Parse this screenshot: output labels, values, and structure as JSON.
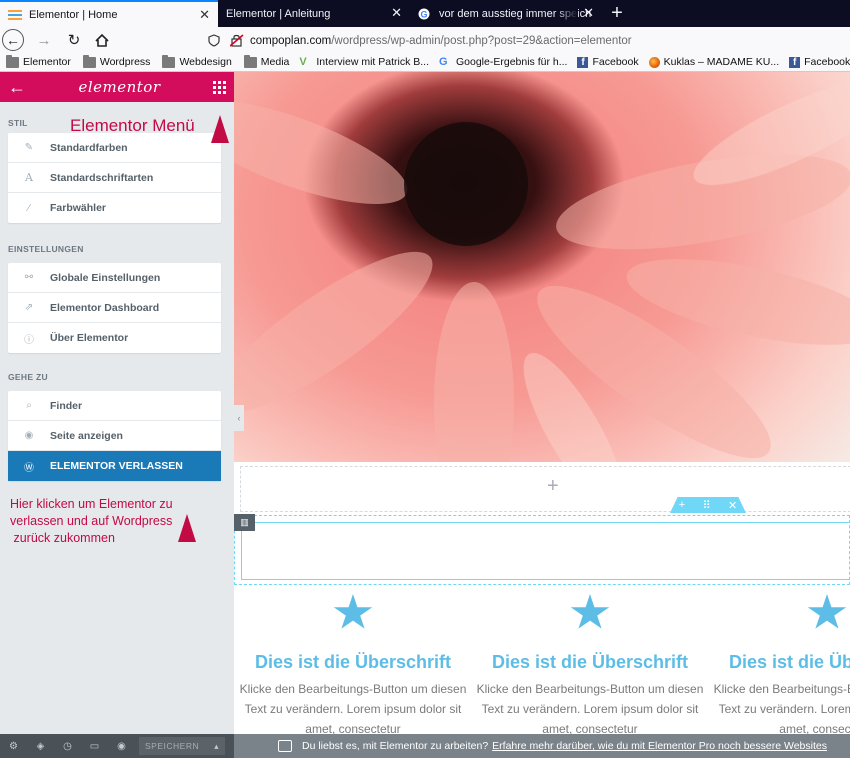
{
  "browser": {
    "tabs": [
      {
        "label": "Elementor | Home",
        "active": true
      },
      {
        "label": "Elementor | Anleitung",
        "active": false
      },
      {
        "label": "vor dem ausstieg immer speich",
        "active": false
      }
    ],
    "url": {
      "host": "compoplan.com",
      "path": "/wordpress/wp-admin/post.php?post=29&action=elementor"
    },
    "bookmarks": [
      {
        "label": "Elementor",
        "icon": "folder-icon"
      },
      {
        "label": "Wordpress",
        "icon": "folder-icon"
      },
      {
        "label": "Webdesign",
        "icon": "folder-icon"
      },
      {
        "label": "Media",
        "icon": "folder-icon"
      },
      {
        "label": "Interview mit Patrick B...",
        "icon": "vimeo-icon"
      },
      {
        "label": "Google-Ergebnis für h...",
        "icon": "google-icon"
      },
      {
        "label": "Facebook",
        "icon": "facebook-icon"
      },
      {
        "label": "Kuklas – MADAME KU...",
        "icon": "firefox-icon"
      },
      {
        "label": "Facebook",
        "icon": "facebook-icon"
      }
    ]
  },
  "panel": {
    "logo": "elementor",
    "sections": [
      {
        "title": "STIL",
        "items": [
          {
            "label": "Standardfarben",
            "icon": "brush-icon"
          },
          {
            "label": "Standardschriftarten",
            "icon": "font-icon"
          },
          {
            "label": "Farbwähler",
            "icon": "eyedropper-icon"
          }
        ]
      },
      {
        "title": "EINSTELLUNGEN",
        "items": [
          {
            "label": "Globale Einstellungen",
            "icon": "sliders-icon"
          },
          {
            "label": "Elementor Dashboard",
            "icon": "external-link-icon"
          },
          {
            "label": "Über Elementor",
            "icon": "info-icon"
          }
        ]
      },
      {
        "title": "GEHE ZU",
        "items": [
          {
            "label": "Finder",
            "icon": "search-icon"
          },
          {
            "label": "Seite anzeigen",
            "icon": "eye-icon"
          },
          {
            "label": "ELEMENTOR VERLASSEN",
            "icon": "wordpress-icon"
          }
        ]
      }
    ],
    "annotation_menu": "Elementor Menü",
    "annotation_exit": [
      "Hier klicken um Elementor zu",
      "verlassen und auf Wordpress",
      " zurück zukommen"
    ]
  },
  "preview": {
    "features": [
      {
        "title": "Dies ist die Überschrift",
        "text": "Klicke den Bearbeitungs-Button um diesen Text zu verändern. Lorem ipsum dolor sit amet, consectetur"
      },
      {
        "title": "Dies ist die Überschrift",
        "text": "Klicke den Bearbeitungs-Button um diesen Text zu verändern. Lorem ipsum dolor sit amet, consectetur"
      },
      {
        "title": "Dies ist die Überschrift",
        "text": "Klicke den Bearbeitungs-Button um diesen Text zu verändern. Lorem ipsum dolor sit amet, consectetur"
      }
    ]
  },
  "footer": {
    "save_label": "SPEICHERN",
    "notice": "Du liebst es, mit Elementor zu arbeiten?",
    "notice_link": "Erfahre mehr darüber, wie du mit Elementor Pro noch bessere Websites"
  },
  "colors": {
    "brand": "#d30c5c",
    "exit_button": "#1a7ab8",
    "accent": "#5dbde6",
    "annotation": "#c20a45"
  }
}
